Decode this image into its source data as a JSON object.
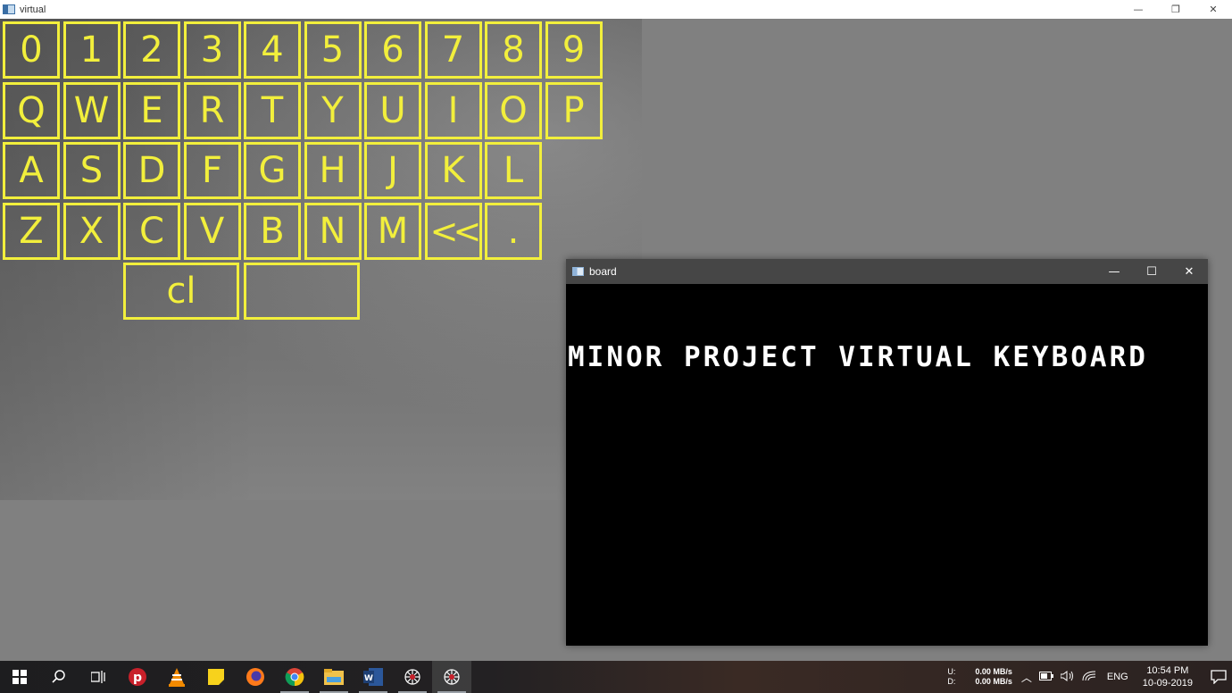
{
  "main_window": {
    "title": "virtual",
    "controls": {
      "minimize": "—",
      "restore": "❐",
      "close": "✕"
    }
  },
  "keyboard": {
    "rows": [
      [
        "0",
        "1",
        "2",
        "3",
        "4",
        "5",
        "6",
        "7",
        "8",
        "9"
      ],
      [
        "Q",
        "W",
        "E",
        "R",
        "T",
        "Y",
        "U",
        "I",
        "O",
        "P"
      ],
      [
        "A",
        "S",
        "D",
        "F",
        "G",
        "H",
        "J",
        "K",
        "L"
      ],
      [
        "Z",
        "X",
        "C",
        "V",
        "B",
        "N",
        "M",
        "<<",
        "."
      ]
    ],
    "bottom_row": [
      "cl",
      ""
    ],
    "key_color": "#f2ef3c"
  },
  "board_window": {
    "title": "board",
    "typed_text": "MINOR PROJECT VIRTUAL KEYBOARD",
    "controls": {
      "minimize": "—",
      "maximize": "☐",
      "close": "✕"
    }
  },
  "taskbar": {
    "icons": [
      "windows-start-icon",
      "search-icon",
      "task-view-icon",
      "psiphon-icon",
      "vlc-icon",
      "sticky-notes-icon",
      "firefox-icon",
      "chrome-icon",
      "file-explorer-icon",
      "word-icon",
      "opencv-window-icon",
      "opencv-window-icon"
    ],
    "network": {
      "up_label": "U:",
      "down_label": "D:",
      "up_value": "0.00 MB/s",
      "down_value": "0.00 MB/s"
    },
    "language": "ENG",
    "time": "10:54 PM",
    "date": "10-09-2019"
  }
}
